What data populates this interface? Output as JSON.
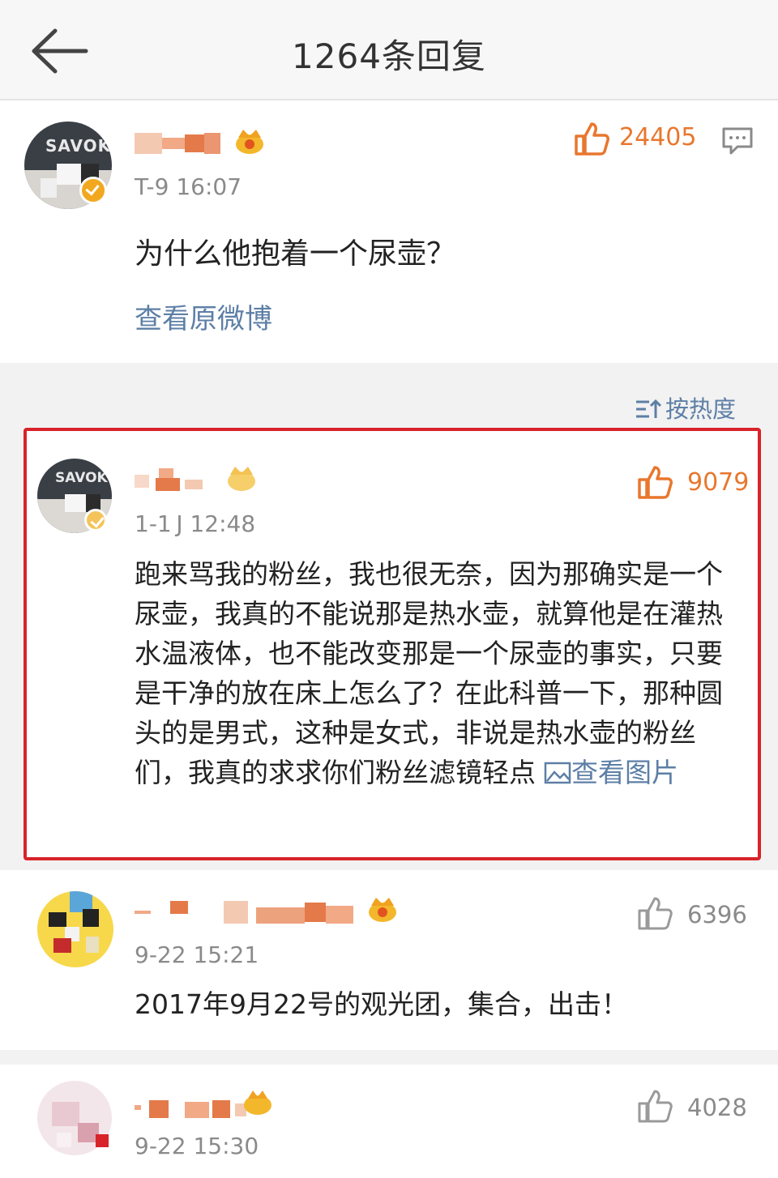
{
  "header": {
    "title": "1264条回复",
    "back_icon": "arrow-left-icon"
  },
  "root_comment": {
    "avatar_text": "SAVOK",
    "time": "T-9 16:07",
    "likes": "24405",
    "text": "为什么他抱着一个尿壶？",
    "view_original": "查看原微博",
    "like_color": "#e8772e"
  },
  "sort": {
    "label": "按热度",
    "icon": "sort-icon"
  },
  "replies": [
    {
      "avatar_text": "SAVOK",
      "time": "1-1 J 12:48",
      "likes": "9079",
      "text": "跑来骂我的粉丝，我也很无奈，因为那确实是一个尿壶，我真的不能说那是热水壶，就算他是在灌热水温液体，也不能改变那是一个尿壶的事实，只要是干净的放在床上怎么了？在此科普一下，那种圆头的是男式，这种是女式，非说是热水壶的粉丝们，我真的求求你们粉丝滤镜轻点",
      "view_image": "查看图片",
      "highlighted_border": "#d8232a"
    },
    {
      "time": "9-22 15:21",
      "likes": "6396",
      "text": "2017年9月22号的观光团，集合，出击！"
    },
    {
      "time": "9-22 15:30",
      "likes": "4028"
    }
  ],
  "colors": {
    "link": "#5d7fa6",
    "like_active": "#e8772e",
    "like_inactive": "#9a9a9a"
  }
}
